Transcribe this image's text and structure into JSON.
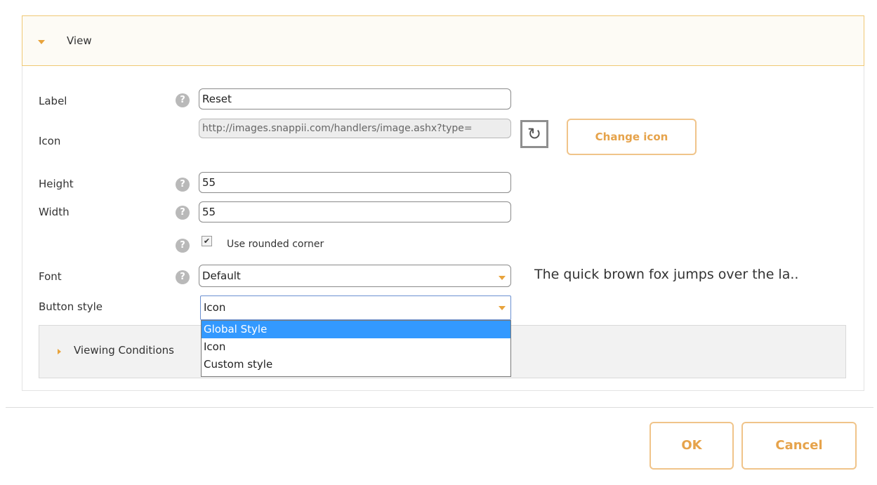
{
  "view_section": {
    "title": "View"
  },
  "form": {
    "label": {
      "label": "Label",
      "value": "Reset"
    },
    "icon": {
      "label": "Icon",
      "value": "http://images.snappii.com/handlers/image.ashx?type=",
      "change_button": "Change icon"
    },
    "height": {
      "label": "Height",
      "value": "55"
    },
    "width": {
      "label": "Width",
      "value": "55"
    },
    "rounded_corner": {
      "label": "Use rounded corner",
      "checked": true
    },
    "font": {
      "label": "Font",
      "value": "Default",
      "preview": "The quick brown fox jumps over the la.."
    },
    "button_style": {
      "label": "Button style",
      "value": "Icon",
      "options": [
        "Global Style",
        "Icon",
        "Custom style"
      ],
      "highlighted": "Global Style"
    }
  },
  "viewing_conditions": {
    "title": "Viewing Conditions"
  },
  "help_glyph": "?",
  "icons": {
    "refresh": "refresh-icon",
    "help": "help-icon",
    "check": "checkmark"
  },
  "footer": {
    "ok": "OK",
    "cancel": "Cancel"
  },
  "colors": {
    "accent": "#e8a33b",
    "header_border": "#f0c874",
    "selection": "#3399ff"
  }
}
